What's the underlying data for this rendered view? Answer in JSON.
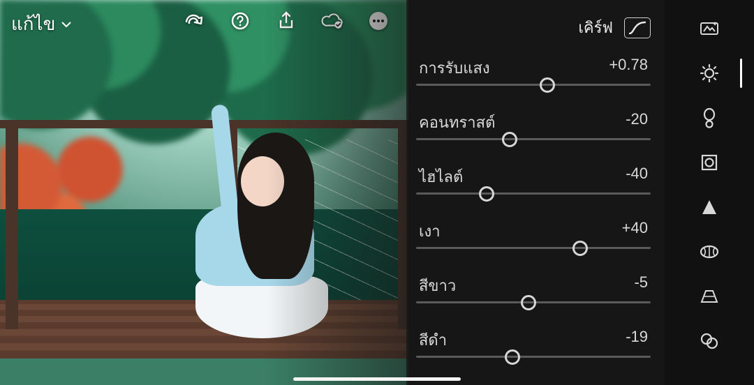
{
  "header": {
    "mode_label": "แก้ไข",
    "icons": [
      "redo",
      "help",
      "share",
      "cloud-done",
      "more"
    ]
  },
  "curve": {
    "label": "เคิร์ฟ"
  },
  "sliders": [
    {
      "name": "การรับแสง",
      "value": "+0.78",
      "pos": 56
    },
    {
      "name": "คอนทราสต์",
      "value": "-20",
      "pos": 40
    },
    {
      "name": "ไฮไลต์",
      "value": "-40",
      "pos": 30
    },
    {
      "name": "เงา",
      "value": "+40",
      "pos": 70
    },
    {
      "name": "สีขาว",
      "value": "-5",
      "pos": 48
    },
    {
      "name": "สีดำ",
      "value": "-19",
      "pos": 41
    }
  ],
  "tools": [
    {
      "id": "auto",
      "active": false
    },
    {
      "id": "light",
      "active": true
    },
    {
      "id": "color",
      "active": false
    },
    {
      "id": "effects",
      "active": false
    },
    {
      "id": "detail",
      "active": false
    },
    {
      "id": "optics",
      "active": false
    },
    {
      "id": "geometry",
      "active": false
    },
    {
      "id": "presets",
      "active": false
    }
  ]
}
